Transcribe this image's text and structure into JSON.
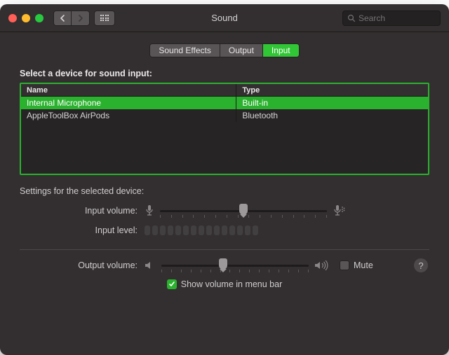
{
  "window": {
    "title": "Sound"
  },
  "search": {
    "placeholder": "Search"
  },
  "tabs": [
    {
      "label": "Sound Effects",
      "active": false
    },
    {
      "label": "Output",
      "active": false
    },
    {
      "label": "Input",
      "active": true
    }
  ],
  "section_title": "Select a device for sound input:",
  "columns": {
    "name": "Name",
    "type": "Type"
  },
  "devices": [
    {
      "name": "Internal Microphone",
      "type": "Built-in",
      "selected": true
    },
    {
      "name": "AppleToolBox AirPods",
      "type": "Bluetooth",
      "selected": false
    }
  ],
  "settings_label": "Settings for the selected device:",
  "input_volume": {
    "label": "Input volume:",
    "value_percent": 50
  },
  "input_level": {
    "label": "Input level:",
    "cells": 15
  },
  "output_volume": {
    "label": "Output volume:",
    "value_percent": 42
  },
  "mute": {
    "label": "Mute",
    "checked": false
  },
  "show_in_menu": {
    "label": "Show volume in menu bar",
    "checked": true
  }
}
